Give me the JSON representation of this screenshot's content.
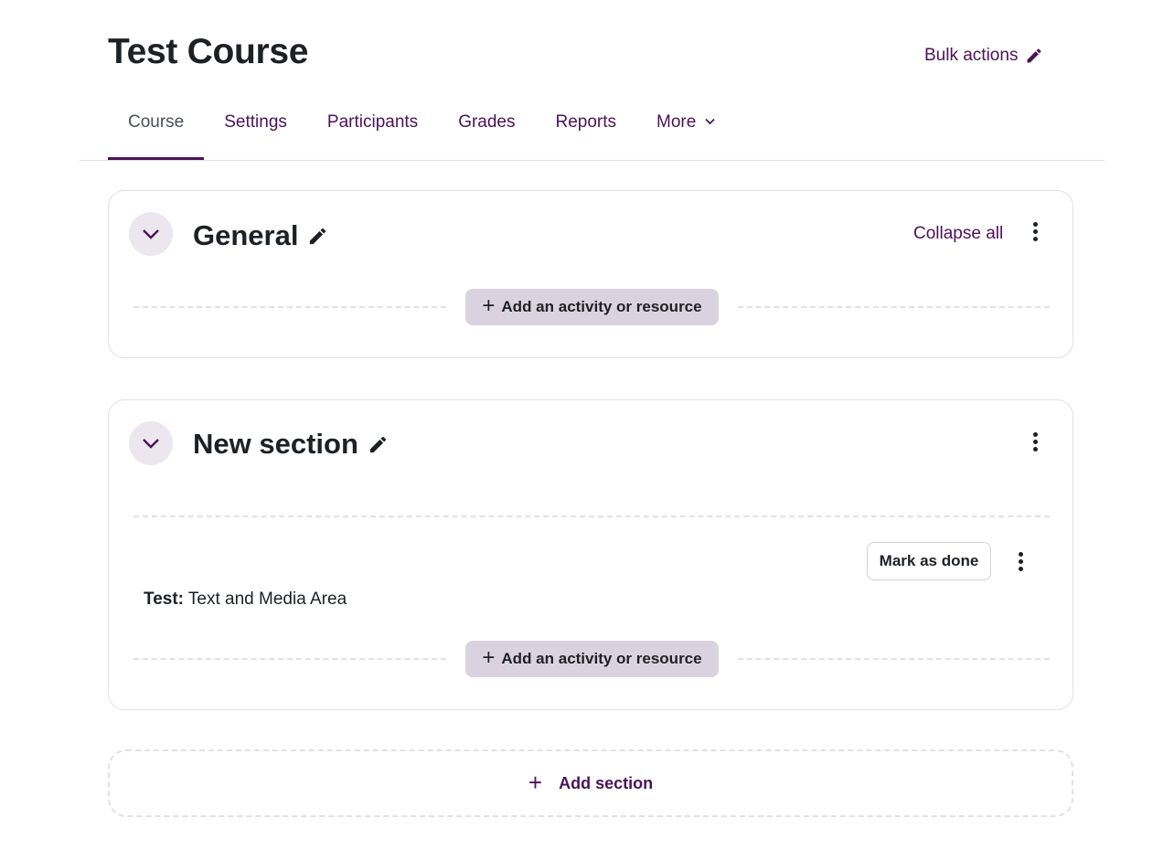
{
  "page": {
    "title": "Test Course"
  },
  "header": {
    "bulk_actions_label": "Bulk actions"
  },
  "tabs": [
    {
      "label": "Course",
      "active": true
    },
    {
      "label": "Settings"
    },
    {
      "label": "Participants"
    },
    {
      "label": "Grades"
    },
    {
      "label": "Reports"
    },
    {
      "label": "More"
    }
  ],
  "sections": [
    {
      "title": "General",
      "collapse_all_label": "Collapse all",
      "add_activity_label": "Add an activity or resource"
    },
    {
      "title": "New section",
      "activity": {
        "name_label": "Test:",
        "name_text": "Text and Media Area",
        "mark_done_label": "Mark as done"
      },
      "add_activity_label": "Add an activity or resource"
    }
  ],
  "add_section_label": "Add section",
  "icons": {
    "pencil": "pencil-icon",
    "chevron": "chevron-down-icon",
    "kebab": "kebab-menu-icon",
    "plus": "plus-icon"
  },
  "colors": {
    "accent": "#4a1359",
    "accent_light": "#dbd2e0",
    "collapse_bg": "#ece6ef",
    "border": "#dee2e6",
    "text": "#1d2125"
  }
}
